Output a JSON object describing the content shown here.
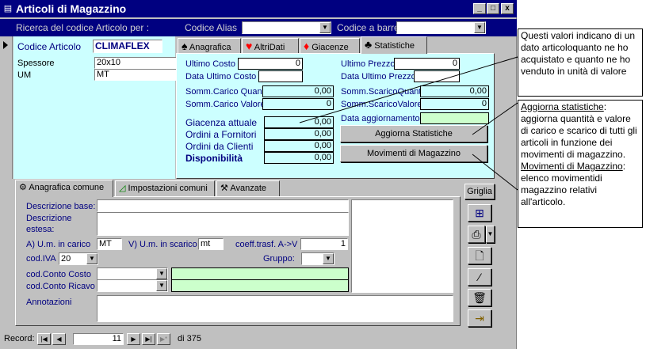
{
  "window": {
    "title": "Articoli di Magazzino",
    "minimize": "_",
    "maximize": "□",
    "close": "x"
  },
  "search": {
    "label": "Ricerca del codice Articolo per :",
    "alias_label": "Codice Alias",
    "alias_value": "",
    "barcode_label": "Codice a barre",
    "barcode_value": ""
  },
  "article": {
    "code_label": "Codice Articolo",
    "code_value": "CLIMAFLEX",
    "spessore_label": "Spessore",
    "spessore_value": "20x10",
    "um_label": "UM",
    "um_value": "MT"
  },
  "top_tabs": [
    {
      "label": "Anagrafica",
      "icon": "♠"
    },
    {
      "label": "AltriDati",
      "icon": "♥"
    },
    {
      "label": "Giacenze",
      "icon": "♦"
    },
    {
      "label": "Statistiche",
      "icon": "♣"
    }
  ],
  "stats": {
    "ultimo_costo_label": "Ultimo Costo",
    "ultimo_costo_value": "0",
    "data_ultimo_costo_label": "Data Ultimo Costo",
    "data_ultimo_costo_value": "",
    "ultimo_prezzo_label": "Ultimo Prezzo",
    "ultimo_prezzo_value": "0",
    "data_ultimo_prezzo_label": "Data Ultimo Prezzo",
    "data_ultimo_prezzo_value": "",
    "somm_carico_quant_label": "Somm.Carico Quant",
    "somm_carico_quant_value": "0,00",
    "somm_carico_valore_label": "Somm.Carico Valore",
    "somm_carico_valore_value": "0",
    "somm_scarico_quant_label": "Somm.ScaricoQuant",
    "somm_scarico_quant_value": "0,00",
    "somm_scarico_valore_label": "Somm.ScaricoValore",
    "somm_scarico_valore_value": "0",
    "giacenza_label": "Giacenza attuale",
    "giacenza_value": "0,00",
    "ordini_fornitori_label": "Ordini a Fornitori",
    "ordini_fornitori_value": "0,00",
    "ordini_clienti_label": "Ordini da Clienti",
    "ordini_clienti_value": "0,00",
    "disponibilita_label": "Disponibilità",
    "disponibilita_value": "0,00",
    "data_aggiornamento_label": "Data aggiornamento",
    "data_aggiornamento_value": "",
    "aggiorna_button": "Aggiorna Statistiche",
    "movimenti_button": "Movimenti di Magazzino"
  },
  "bottom_tabs": [
    {
      "label": "Anagrafica comune",
      "icon": "gears-icon"
    },
    {
      "label": "Impostazioni comuni",
      "icon": "chart-icon"
    },
    {
      "label": "Avanzate",
      "icon": "tools-icon"
    }
  ],
  "anagrafica": {
    "descrizione_base_label": "Descrizione base:",
    "descrizione_base_value": "",
    "descrizione_estesa_label": "Descrizione estesa:",
    "descrizione_estesa_value": "",
    "um_carico_label": "A) U.m. in carico",
    "um_carico_value": "MT",
    "um_scarico_label": "V) U.m. in scarico",
    "um_scarico_value": "mt",
    "coeff_label": "coeff.trasf. A->V",
    "coeff_value": "1",
    "cod_iva_label": "cod.IVA",
    "cod_iva_value": "20",
    "gruppo_label": "Gruppo:",
    "gruppo_value": "",
    "conto_costo_label": "cod.Conto Costo",
    "conto_costo_value": "",
    "conto_ricavo_label": "cod.Conto Ricavo",
    "conto_ricavo_value": "",
    "annotazioni_label": "Annotazioni",
    "annotazioni_value": ""
  },
  "side_buttons": {
    "griglia": "Griglia"
  },
  "navigator": {
    "record_label": "Record:",
    "current": "11",
    "total_label": "di 375"
  },
  "callouts": {
    "stats_note": "Questi valori indicano di un dato articoloquanto ne ho acquistato e quanto ne ho venduto in unità di valore",
    "aggiorna_title": "Aggiorna statistiche",
    "aggiorna_text": ": aggiorna quantità e valore di carico e scarico di tutti gli articoli in funzione dei movimenti di magazzino.",
    "movimenti_title": "Movimenti di Magazzino",
    "movimenti_text": ": elenco movimentidi magazzino relativi all'articolo."
  }
}
